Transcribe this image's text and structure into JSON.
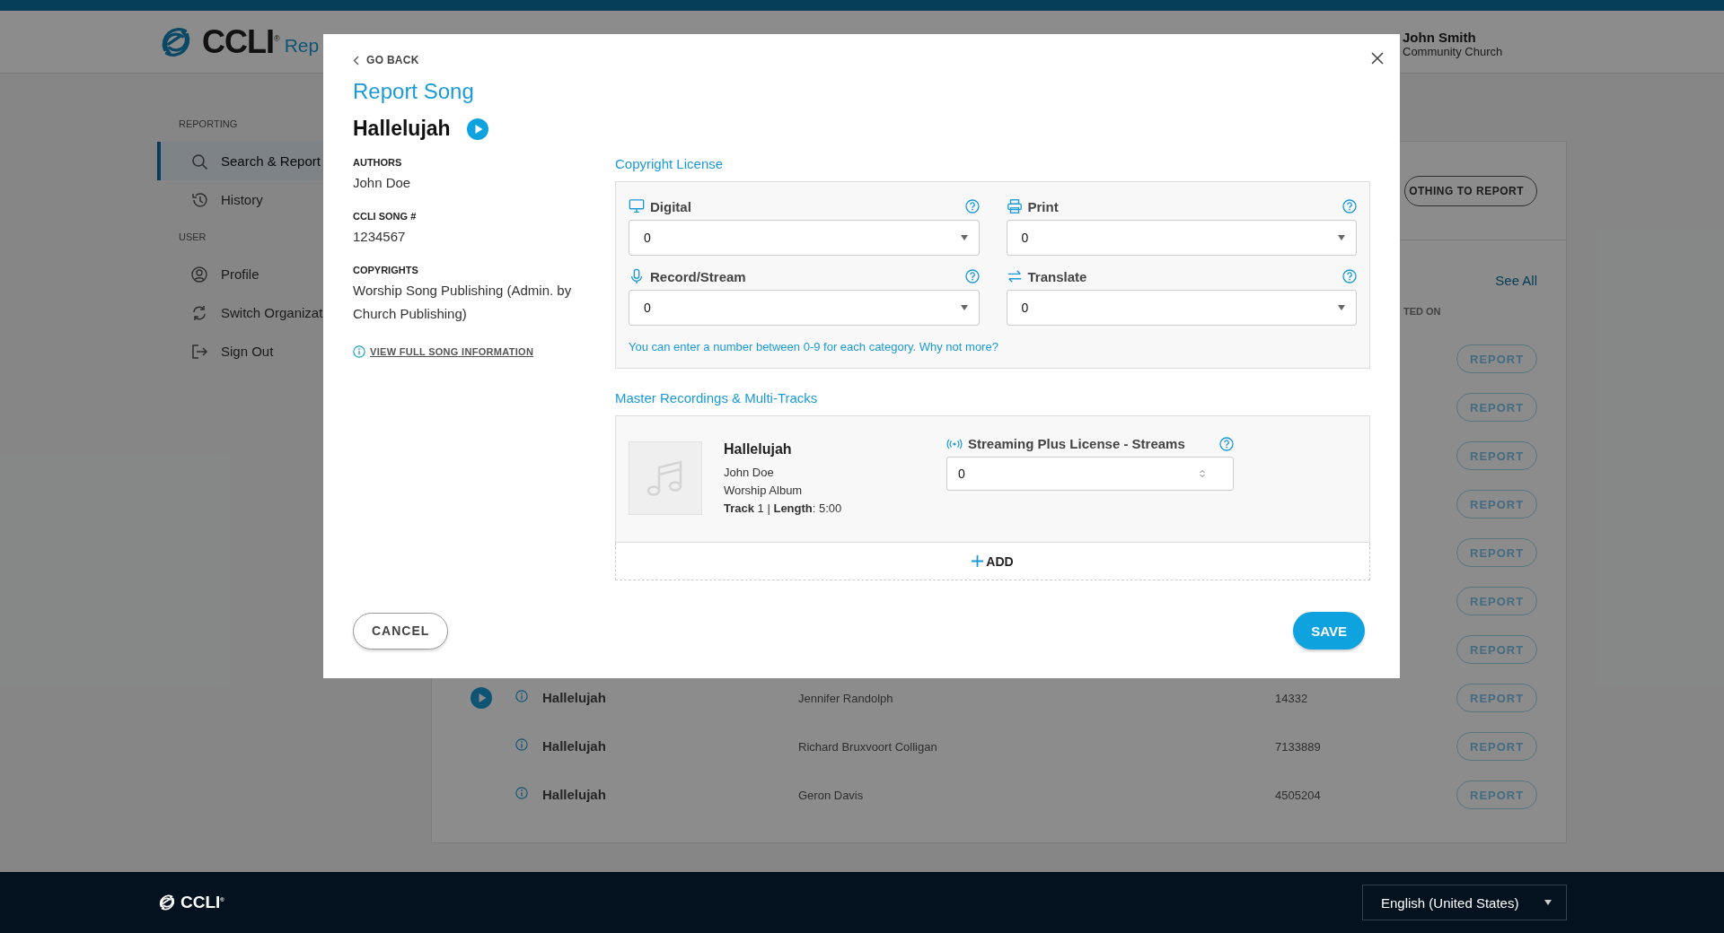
{
  "header": {
    "logo": "CCLI$^{®}$",
    "title": "Rep",
    "user": {
      "name": "John Smith",
      "organization": "Community Church"
    }
  },
  "sidebar": {
    "sections": [
      {
        "heading": "REPORTING",
        "items": [
          {
            "kind": "search",
            "label": "Search & Report",
            "selected": true
          },
          {
            "kind": "history",
            "label": "History",
            "selected": false
          }
        ]
      },
      {
        "heading": "USER",
        "items": [
          {
            "kind": "profile",
            "label": "Profile",
            "selected": false
          },
          {
            "kind": "switch",
            "label": "Switch Organizat",
            "selected": false
          },
          {
            "kind": "sign-out",
            "label": "Sign Out",
            "selected": false
          }
        ]
      }
    ]
  },
  "main": {
    "nothing_button": "OTHING TO REPORT",
    "see_all": "See All",
    "column_header": "TED ON",
    "rows": [
      {
        "action": "REPORT"
      },
      {
        "action": "REPORT"
      },
      {
        "action": "REPORT"
      },
      {
        "action": "REPORT"
      },
      {
        "action": "REPORT"
      },
      {
        "action": "REPORT"
      },
      {
        "action": "REPORT"
      },
      {
        "has_audio": true,
        "title": "Hallelujah",
        "author": "Jennifer Randolph",
        "song_number": "14332",
        "action": "REPORT"
      },
      {
        "has_audio": false,
        "title": "Hallelujah",
        "author": "Richard Bruxvoort Colligan",
        "song_number": "7133889",
        "action": "REPORT"
      },
      {
        "has_audio": false,
        "title": "Hallelujah",
        "author": "Geron Davis",
        "song_number": "4505204",
        "action": "REPORT"
      }
    ]
  },
  "modal": {
    "back": "GO BACK",
    "title": "Report Song",
    "song": {
      "title": "Hallelujah",
      "details": [
        {
          "label": "AUTHORS",
          "value": "John Doe"
        },
        {
          "label": "CCLI SONG #",
          "value": "1234567"
        },
        {
          "label": "COPYRIGHTS",
          "value": "Worship Song Publishing (Admin. by Church Publishing)"
        }
      ],
      "info_link": "VIEW FULL SONG INFORMATION"
    },
    "copyright_license": {
      "heading": "Copyright License",
      "fields": [
        {
          "kind": "digital",
          "label": "Digital",
          "value": "0"
        },
        {
          "kind": "print",
          "label": "Print",
          "value": "0"
        },
        {
          "kind": "record",
          "label": "Record/Stream",
          "value": "0"
        },
        {
          "kind": "translate",
          "label": "Translate",
          "value": "0"
        }
      ],
      "note": "You can enter a number between 0-9 for each category. Why not more?"
    },
    "master_recordings": {
      "heading": "Master Recordings & Multi-Tracks",
      "tracks": [
        {
          "title": "Hallelujah",
          "artist": "John Doe",
          "album": "Worship Album",
          "track_line": "**Track** 1 | **Length**: 5:00",
          "field": {
            "label": "Streaming Plus License - Streams",
            "value": "0"
          }
        }
      ],
      "add_button": "ADD"
    },
    "buttons": {
      "cancel": "CANCEL",
      "save": "SAVE"
    }
  },
  "footer": {
    "logo": "CCLI$^{®}$",
    "language": "English (United States)"
  }
}
